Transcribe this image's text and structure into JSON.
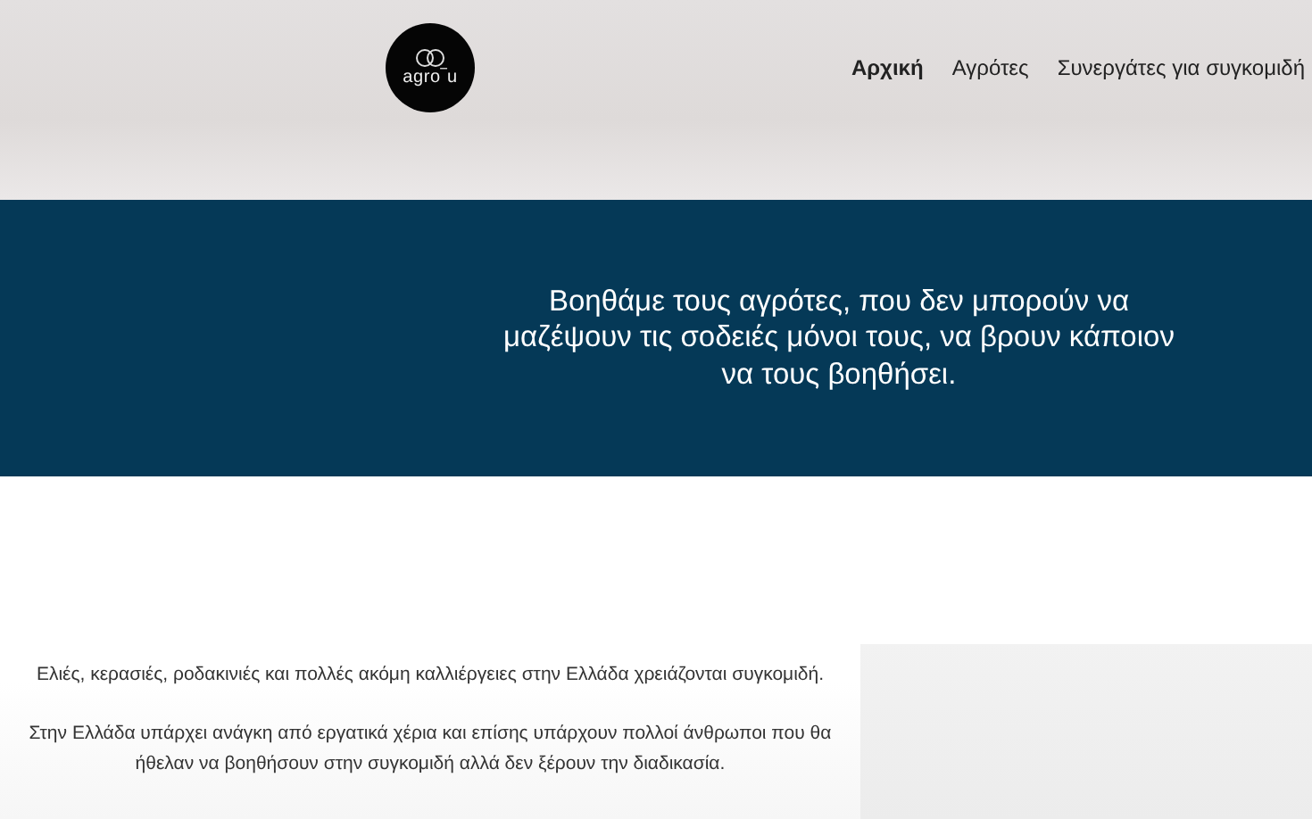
{
  "logo": {
    "text": "agro‾u"
  },
  "nav": [
    {
      "label": "Αρχική",
      "selected": true
    },
    {
      "label": "Αγρότες",
      "selected": false
    },
    {
      "label": "Συνεργάτες για συγκομιδή",
      "selected": false
    }
  ],
  "hero": {
    "text": "Βοηθάμε τους αγρότες, που δεν μπορούν να μαζέψουν τις σοδειές μόνοι τους, να βρουν κάποιον να τους βοηθήσει."
  },
  "intro": [
    "Ελιές, κερασιές, ροδακινιές και πολλές ακόμη καλλιέργειες στην Ελλάδα χρειάζονται συγκομιδή.",
    "Στην Ελλάδα υπάρχει ανάγκη από εργατικά χέρια και επίσης υπάρχουν πολλοί άνθρωποι που θα ήθελαν να βοηθήσουν στην συγκομιδή αλλά δεν ξέρουν την διαδικασία."
  ]
}
